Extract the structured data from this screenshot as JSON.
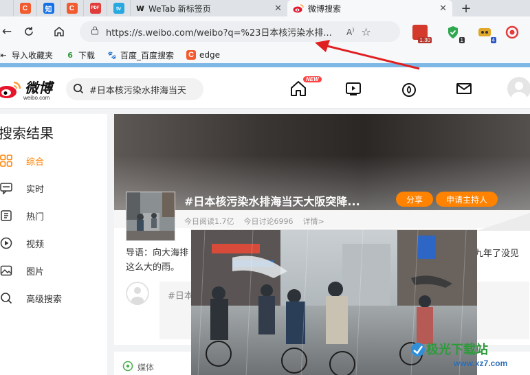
{
  "browser": {
    "tabs": [
      {
        "favicon": "C",
        "color": "#f25b30"
      },
      {
        "favicon": "知",
        "color": "#1771e6"
      },
      {
        "favicon": "C",
        "color": "#f25b30"
      },
      {
        "favicon": "PDF",
        "color": "#e13c3c"
      },
      {
        "favicon": "tv",
        "color": "#27a8e0"
      }
    ],
    "wetab_title": "WeTab 新标签页",
    "active_tab_title": "微博搜索",
    "address_url": "https://s.weibo.com/weibo?q=%23日本核污染水排...",
    "extensions": [
      {
        "badge": "1.30",
        "color": "#d33a2c"
      },
      {
        "badge": "1",
        "color": "#2fa84f"
      },
      {
        "badge": "4",
        "color": "#e0a72a"
      },
      {
        "badge": "",
        "color": "#e43a3a"
      }
    ],
    "bookmarks": [
      {
        "label": "导入收藏夹"
      },
      {
        "label": "下载"
      },
      {
        "label": "百度_百度搜索"
      },
      {
        "label": "edge"
      }
    ]
  },
  "weibo": {
    "logo_text": "微博",
    "logo_sub": "weibo.com",
    "search_value": "#日本核污染水排海当天",
    "new_badge": "NEW",
    "sidebar": {
      "title": "搜索结果",
      "items": [
        {
          "label": "综合",
          "icon": "grid-icon",
          "active": true
        },
        {
          "label": "实时",
          "icon": "chat-icon",
          "active": false
        },
        {
          "label": "热门",
          "icon": "fire-icon",
          "active": false
        },
        {
          "label": "视频",
          "icon": "play-icon",
          "active": false
        },
        {
          "label": "图片",
          "icon": "image-icon",
          "active": false
        },
        {
          "label": "高级搜索",
          "icon": "search-icon",
          "active": false
        }
      ]
    },
    "topic": {
      "title": "#日本核污染水排海当天大阪突降...",
      "share_label": "分享",
      "host_label": "申请主持人",
      "read_stat": "今日阅读1.7亿",
      "discuss_stat": "今日讨论6996",
      "detail_link": "详情>",
      "intro_left": "导语：向大海排",
      "intro_line2": "这么大的雨。",
      "intro_right": "九年了没见",
      "comment_prefix": "#日本"
    },
    "media_label": "媒体"
  },
  "watermark": {
    "text": "极光下载站",
    "url": "www.xz7.com"
  },
  "colors": {
    "accent": "#ff8200",
    "annotation_arrow": "#e02020"
  }
}
